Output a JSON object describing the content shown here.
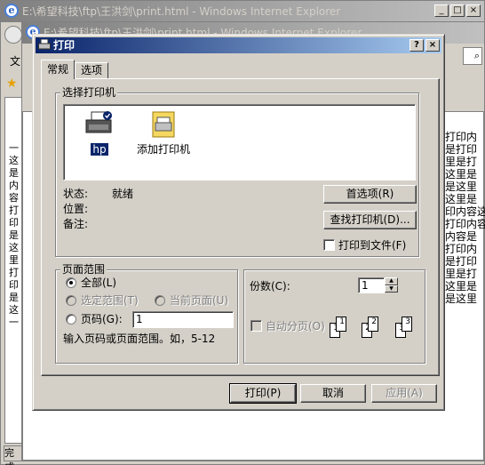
{
  "ie_back": {
    "title": "E:\\希望科技\\ftp\\王洪剑\\print.html - Windows Internet Explorer",
    "menu_first": "文",
    "status_text": "完成"
  },
  "ie_mid": {
    "title": "E:\\希望科技\\ftp\\王洪剑\\print.html - Windows Internet Explorer"
  },
  "window_buttons": {
    "minimize": "_",
    "maximize": "□",
    "close": "×"
  },
  "background_right_text": [
    "打印内",
    "是打印",
    "里是打",
    "这里是",
    "是这里",
    "这里是",
    "印内容这",
    "打印内容",
    "内容是",
    "打印内",
    "是打印",
    "里是打",
    "这里是",
    "是这里"
  ],
  "background_left_text": [
    "一",
    "这",
    "是",
    "内",
    "容",
    "打",
    "印",
    "是",
    "这",
    "里",
    "打",
    "印",
    "是",
    "这",
    "一"
  ],
  "dialog": {
    "title": "打印",
    "help_btn": "?",
    "close_btn": "×",
    "tabs": [
      {
        "label": "常规"
      },
      {
        "label": "选项"
      }
    ],
    "select_printer_label": "选择打印机",
    "printers": [
      {
        "label": "hp",
        "selected": true
      },
      {
        "label": "添加打印机",
        "selected": false
      }
    ],
    "status_label": "状态:",
    "status_value": "就绪",
    "location_label": "位置:",
    "comment_label": "备注:",
    "preferences_btn": "首选项(R)",
    "find_printer_btn": "查找打印机(D)...",
    "print_to_file_label": "打印到文件(F)",
    "print_to_file_checked": false,
    "page_range": {
      "legend": "页面范围",
      "all_label": "全部(L)",
      "all_checked": true,
      "selection_label": "选定范围(T)",
      "current_page_label": "当前页面(U)",
      "pages_label": "页码(G):",
      "pages_value": "1",
      "hint": "输入页码或页面范围。如，5-12"
    },
    "copies": {
      "label": "份数(C):",
      "value": "1",
      "collate_label": "自动分页(O)",
      "collate_checked": false,
      "page_numbers": [
        "1",
        "1",
        "2",
        "2",
        "3",
        "3"
      ]
    },
    "print_btn": "打印(P)",
    "cancel_btn": "取消",
    "apply_btn": "应用(A)"
  }
}
